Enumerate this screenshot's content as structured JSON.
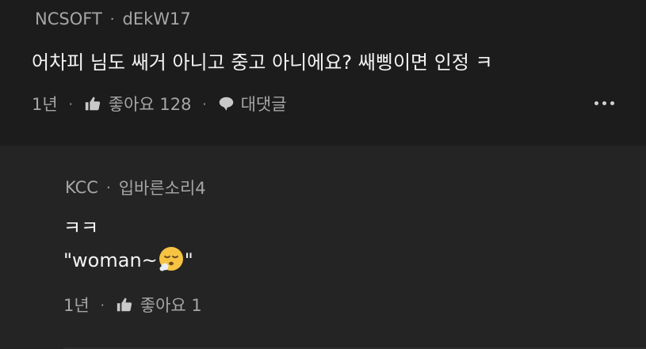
{
  "comments": [
    {
      "author": "NCSOFT",
      "nickname": "dEkW17",
      "text": "어차피 님도 쌔거 아니고 중고 아니에요? 쌔삥이면 인정 ㅋ",
      "time": "1년",
      "likes_label": "좋아요 128",
      "reply_label": "대댓글"
    }
  ],
  "reply": {
    "author": "KCC",
    "nickname": "입바른소리4",
    "line1": "ㅋㅋ",
    "line2_before": "\"woman~",
    "line2_after": "\"",
    "emoji": "exhaling-face-emoji",
    "time": "1년",
    "likes_label": "좋아요 1"
  },
  "colors": {
    "background": "#1c1c1c",
    "reply_background": "#242424",
    "meta_text": "#a6a6a6",
    "body_text": "#f4f4f4"
  },
  "icons": {
    "separator": "·",
    "like": "thumbs-up-icon",
    "reply": "speech-bubble-icon",
    "more": "more-dots-icon"
  }
}
